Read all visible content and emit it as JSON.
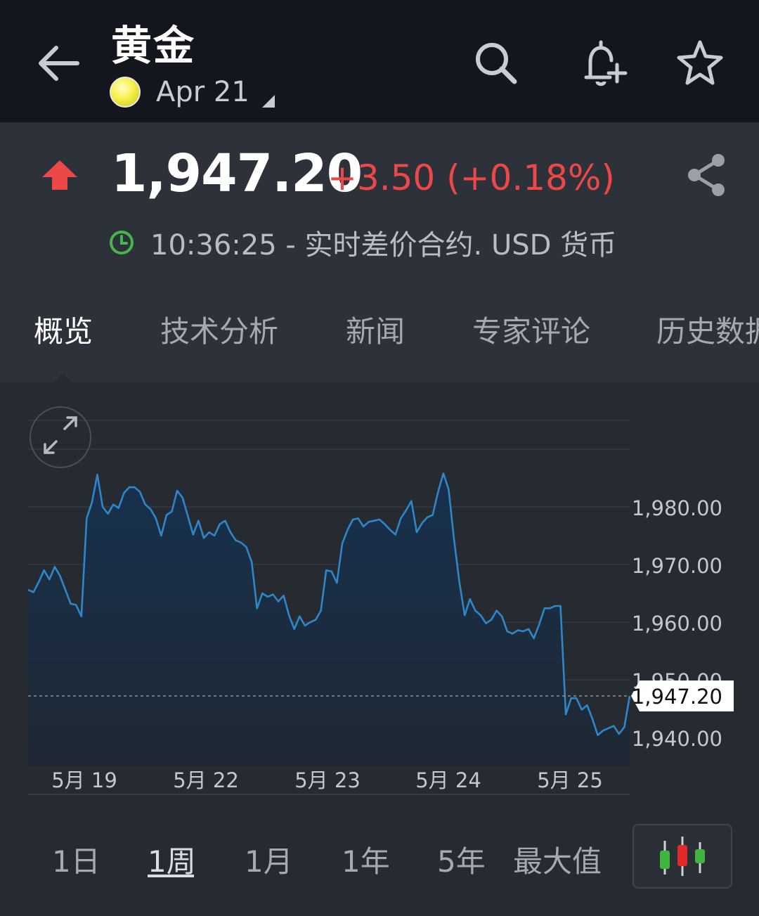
{
  "header": {
    "title": "黄金",
    "contract": "Apr 21"
  },
  "quote": {
    "price": "1,947.20",
    "change": "+3.50 (+0.18%)",
    "time_info": "10:36:25 - 实时差价合约. USD 货币",
    "direction": "up"
  },
  "tabs": [
    {
      "label": "概览",
      "active": true
    },
    {
      "label": "技术分析",
      "active": false
    },
    {
      "label": "新闻",
      "active": false
    },
    {
      "label": "专家评论",
      "active": false
    },
    {
      "label": "历史数据",
      "active": false
    }
  ],
  "ranges": [
    {
      "label": "1日",
      "active": false
    },
    {
      "label": "1周",
      "active": true
    },
    {
      "label": "1月",
      "active": false
    },
    {
      "label": "1年",
      "active": false
    },
    {
      "label": "5年",
      "active": false
    },
    {
      "label": "最大值",
      "active": false
    }
  ],
  "colors": {
    "up": "#ec4848",
    "line": "#2f86c8",
    "clock": "#49b34c"
  },
  "chart_data": {
    "type": "area",
    "ylim": [
      1935,
      1995
    ],
    "yticks": [
      1940,
      1950,
      1960,
      1970,
      1980
    ],
    "ytick_labels": [
      "1,940.00",
      "1,950.00",
      "1,960.00",
      "1,970.00",
      "1,980.00"
    ],
    "x_labels": [
      "5月 19",
      "5月 22",
      "5月 23",
      "5月 24",
      "5月 25"
    ],
    "current_value": 1947.2,
    "current_label": "1,947.20",
    "series": [
      {
        "values": [
          1965.6,
          1965.2,
          1967.0,
          1969.0,
          1967.4,
          1969.6,
          1968.0,
          1965.6,
          1963.2,
          1963.0,
          1961.0,
          1978.0,
          1980.8,
          1985.6,
          1980.0,
          1978.8,
          1980.4,
          1979.8,
          1982.4,
          1983.4,
          1983.4,
          1982.6,
          1980.4,
          1979.6,
          1978.0,
          1975.0,
          1978.6,
          1979.2,
          1982.8,
          1981.6,
          1978.4,
          1975.2,
          1977.6,
          1974.6,
          1975.6,
          1975.0,
          1977.0,
          1977.6,
          1975.6,
          1974.2,
          1973.8,
          1973.0,
          1970.4,
          1962.4,
          1965.0,
          1964.4,
          1964.8,
          1963.6,
          1964.6,
          1961.2,
          1958.8,
          1961.0,
          1959.4,
          1960.0,
          1960.4,
          1962.0,
          1969.0,
          1968.8,
          1966.8,
          1973.6,
          1976.0,
          1977.8,
          1978.0,
          1976.6,
          1977.4,
          1977.6,
          1977.8,
          1977.0,
          1976.0,
          1975.2,
          1978.0,
          1979.4,
          1981.0,
          1975.6,
          1977.2,
          1978.2,
          1978.6,
          1982.6,
          1985.8,
          1983.0,
          1974.4,
          1967.0,
          1961.2,
          1964.0,
          1962.0,
          1961.2,
          1959.8,
          1960.4,
          1962.0,
          1961.0,
          1958.4,
          1958.0,
          1958.6,
          1958.4,
          1958.8,
          1957.2,
          1959.6,
          1962.4,
          1962.4,
          1962.8,
          1962.8,
          1944.0,
          1946.8,
          1946.8,
          1944.8,
          1945.6,
          1943.2,
          1940.4,
          1941.2,
          1941.6,
          1942.0,
          1940.6,
          1941.8,
          1947.2
        ]
      }
    ]
  }
}
